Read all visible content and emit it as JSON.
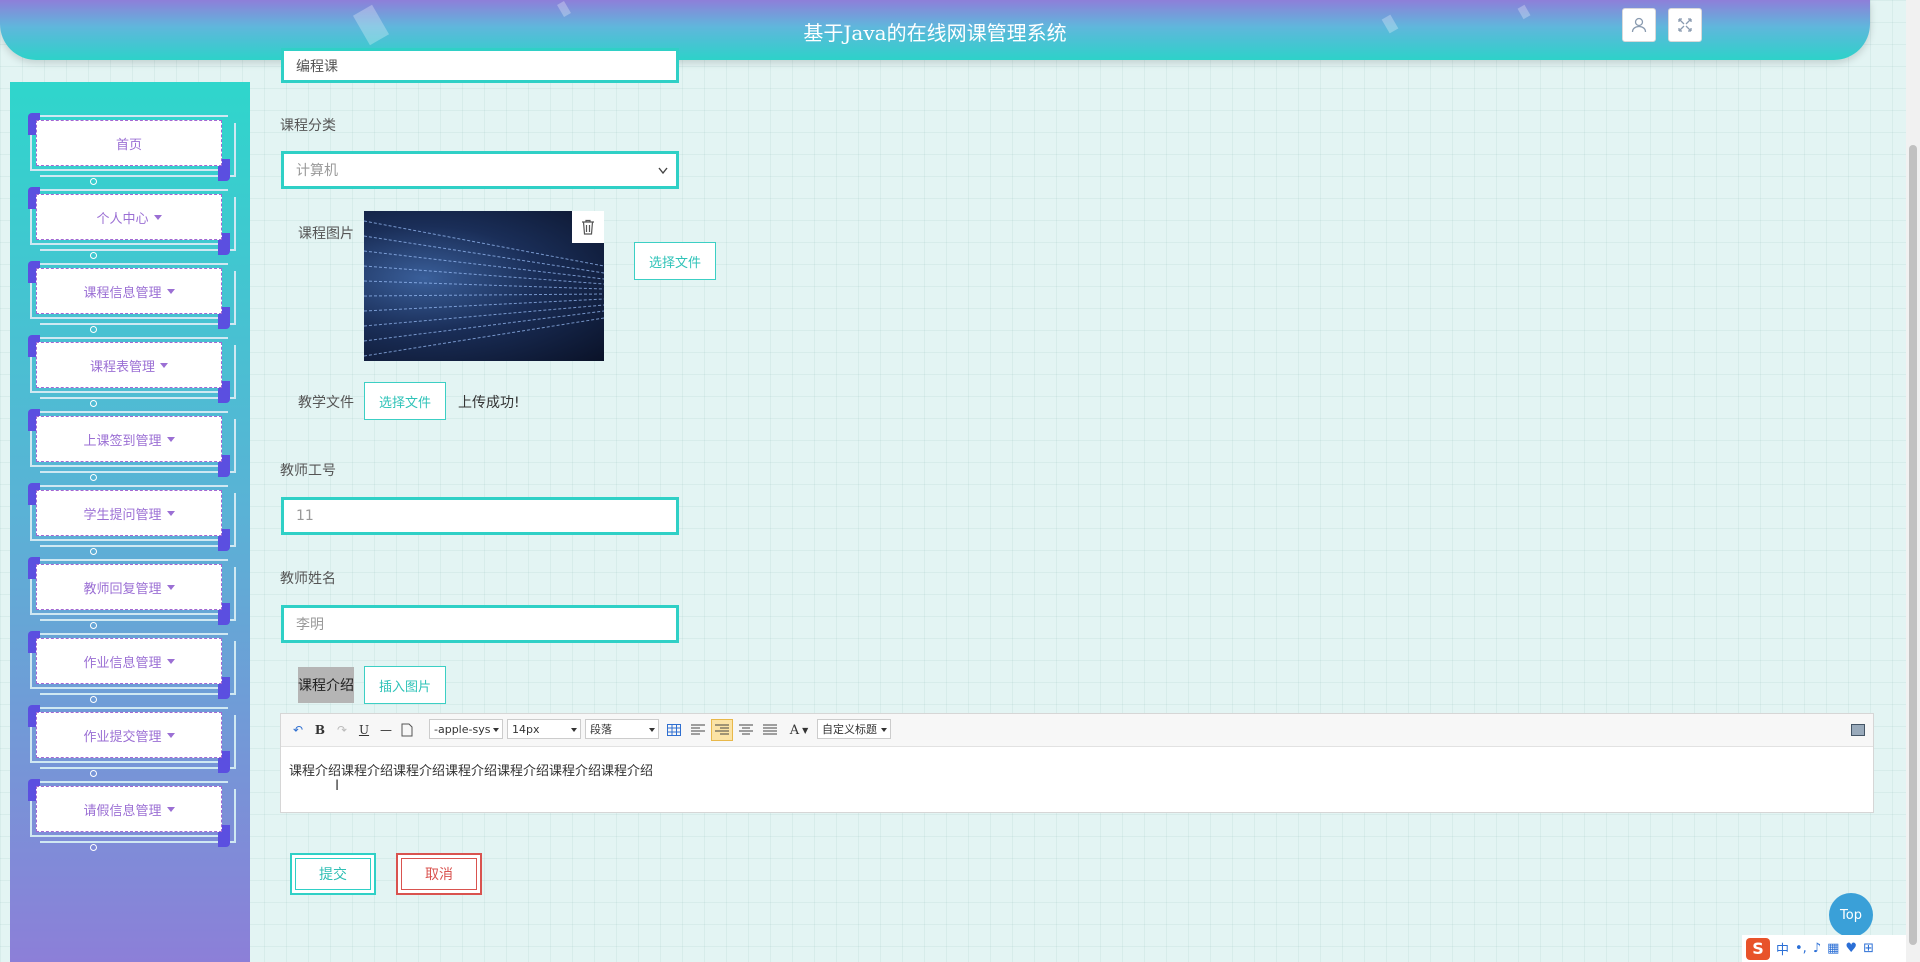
{
  "header": {
    "title": "基于Java的在线网课管理系统"
  },
  "sidebar": {
    "items": [
      {
        "label": "首页",
        "caret": false
      },
      {
        "label": "个人中心",
        "caret": true
      },
      {
        "label": "课程信息管理",
        "caret": true
      },
      {
        "label": "课程表管理",
        "caret": true
      },
      {
        "label": "上课签到管理",
        "caret": true
      },
      {
        "label": "学生提问管理",
        "caret": true
      },
      {
        "label": "教师回复管理",
        "caret": true
      },
      {
        "label": "作业信息管理",
        "caret": true
      },
      {
        "label": "作业提交管理",
        "caret": true
      },
      {
        "label": "请假信息管理",
        "caret": true
      }
    ]
  },
  "form": {
    "course_type_value": "编程课",
    "category": {
      "label": "课程分类",
      "value": "计算机"
    },
    "image": {
      "label": "课程图片",
      "choose_label": "选择文件"
    },
    "teaching_file": {
      "label": "教学文件",
      "choose_label": "选择文件",
      "status": "上传成功!"
    },
    "teacher_id": {
      "label": "教师工号",
      "value": "11"
    },
    "teacher_name": {
      "label": "教师姓名",
      "value": "李明"
    },
    "intro": {
      "label": "课程介绍",
      "insert_image_label": "插入图片"
    }
  },
  "editor": {
    "font_family": "-apple-sys",
    "font_size": "14px",
    "paragraph": "段落",
    "custom_title": "自定义标题",
    "content": "课程介绍课程介绍课程介绍课程介绍课程介绍课程介绍课程介绍"
  },
  "actions": {
    "submit_label": "提交",
    "cancel_label": "取消"
  },
  "top_button": {
    "label": "Top"
  },
  "colors": {
    "accent": "#2fd0c6",
    "sidebar_text": "#9b6fd4",
    "danger": "#d9534f",
    "header_top": "#8e7fd9"
  }
}
